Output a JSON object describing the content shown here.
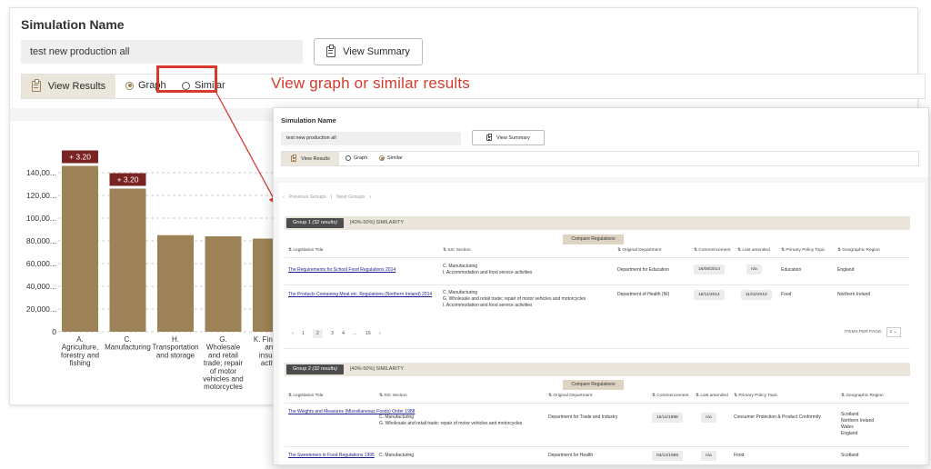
{
  "back": {
    "title": "Simulation Name",
    "simulation_name_value": "test new production all",
    "view_summary_label": "View Summary",
    "view_results_label": "View Results",
    "graph_label": "Graph",
    "similar_label": "Similar",
    "graph_selected": true
  },
  "callout": "View graph or similar results",
  "colors": {
    "accent": "#9c8256",
    "highlight": "#d63a2e",
    "label_bg": "#7a2323"
  },
  "chart_data": {
    "type": "bar",
    "categories": [
      "A. Agriculture, forestry and fishing",
      "C. Manufacturing",
      "H. Transportation and storage",
      "G. Wholesale and retail trade; repair of motor vehicles and motorcycles",
      "K. Financial and insurance activities"
    ],
    "category_lines": [
      [
        "A.",
        "Agriculture,",
        "forestry and",
        "fishing"
      ],
      [
        "C.",
        "Manufacturing"
      ],
      [
        "H.",
        "Transportation",
        "and storage"
      ],
      [
        "G.",
        "Wholesale",
        "and retail",
        "trade; repair",
        "of motor",
        "vehicles and",
        "motorcycles"
      ],
      [
        "K. Finance",
        "and",
        "insuran",
        "activiti"
      ]
    ],
    "values": [
      146000,
      126000,
      85000,
      84000,
      82000
    ],
    "annotations": [
      {
        "index": 0,
        "text": "+ 3.20"
      },
      {
        "index": 1,
        "text": "+ 3.20"
      }
    ],
    "yticks": [
      "140,00...",
      "120,00...",
      "100,00...",
      "80,000...",
      "60,000...",
      "40,000...",
      "20,000...",
      "0"
    ],
    "ytick_values": [
      140000,
      120000,
      100000,
      80000,
      60000,
      40000,
      20000,
      0
    ],
    "ylim": [
      0,
      160000
    ],
    "color": "#9c8256"
  },
  "front": {
    "title": "Simulation Name",
    "simulation_name_value": "test new production all",
    "view_summary_label": "View Summary",
    "view_results_label": "View Results",
    "graph_label": "Graph",
    "similar_label": "Similar",
    "previous_groups": "Previous Groups",
    "next_groups": "Next Groups",
    "columns": {
      "title": "Legislation Title",
      "sic": "SIC Section",
      "dept": "Original Department",
      "commencement": "Commencement",
      "amended": "Last amended",
      "topic": "Primary Policy Topic",
      "region": "Geographic Region"
    },
    "compare_label": "Compare Regulations",
    "group1": {
      "badge": "Group 1",
      "badge_count": "(32 results)",
      "similarity": "[40%-50%] SIMILARITY",
      "rows": [
        {
          "title": "The Requirements for School Food Regulations 2014",
          "sic": [
            "C. Manufacturing",
            "I. Accommodation and food service activities"
          ],
          "dept": "Department for Education",
          "commencement": "16/06/2014",
          "amended": "n/a",
          "topic": "Education",
          "region": [
            "England"
          ]
        },
        {
          "title": "The Products Containing Meat etc. Regulations (Northern Ireland) 2014",
          "sic": [
            "C. Manufacturing",
            "G. Wholesale and retail trade; repair of motor vehicles and motorcycles",
            "I. Accommodation and food service activities"
          ],
          "dept": "Department of Health (NI)",
          "commencement": "18/11/2014",
          "amended": "11/02/2019",
          "topic": "Food",
          "region": [
            "Northern Ireland"
          ]
        }
      ]
    },
    "pagination": {
      "pages": [
        "1",
        "2",
        "3",
        "4",
        "...",
        "16"
      ],
      "current": "2",
      "prev": "‹",
      "next": "›",
      "items_per_page_label": "ITEMS PER PAGE:",
      "items_per_page_value": "2"
    },
    "group2": {
      "badge": "Group 2",
      "badge_count": "(32 results)",
      "similarity": "[40%-50%] SIMILARITY",
      "rows": [
        {
          "title": "The Weights and Measures (Miscellaneous Foods) Order 1988",
          "sic": [
            "C. Manufacturing",
            "G. Wholesale and retail trade; repair of motor vehicles and motorcycles"
          ],
          "dept": "Department for Trade and Industry",
          "commencement": "16/11/1988",
          "amended": "n/a",
          "topic": "Consumer Protection & Product Conformity",
          "region": [
            "Scotland",
            "Northern Ireland",
            "Wales",
            "England"
          ]
        },
        {
          "title": "The Sweeteners in Food Regulations 1995",
          "sic": [
            "C. Manufacturing"
          ],
          "dept": "Department for Health",
          "commencement": "03/12/1995",
          "amended": "n/a",
          "topic": "Food",
          "region": [
            "Scotland"
          ]
        }
      ]
    }
  }
}
